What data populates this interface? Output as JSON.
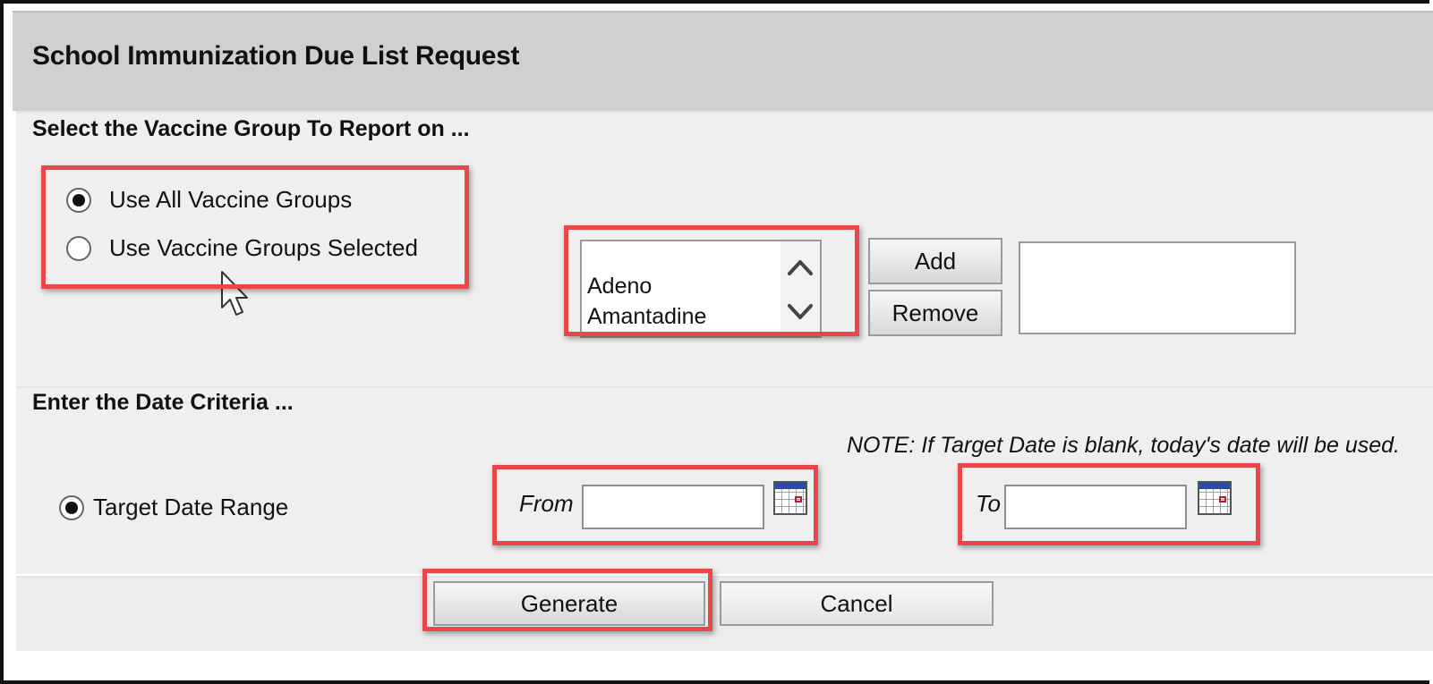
{
  "header": {
    "title": "School Immunization Due List Request"
  },
  "vaccine_section": {
    "heading": "Select the Vaccine Group To Report on ...",
    "options": [
      {
        "label": "Use All Vaccine Groups",
        "selected": true
      },
      {
        "label": "Use Vaccine Groups Selected",
        "selected": false
      }
    ],
    "available_list": [
      "Adeno",
      "Amantadine"
    ],
    "add_label": "Add",
    "remove_label": "Remove"
  },
  "date_section": {
    "heading": "Enter the Date Criteria ...",
    "note": "NOTE: If Target Date is blank, today's date will be used.",
    "target_label": "Target Date Range",
    "from_label": "From",
    "to_label": "To",
    "from_value": "",
    "to_value": ""
  },
  "footer": {
    "generate_label": "Generate",
    "cancel_label": "Cancel"
  },
  "colors": {
    "highlight": "#e8474b",
    "title_bar": "#d0d0d0",
    "panel": "#efefef"
  }
}
